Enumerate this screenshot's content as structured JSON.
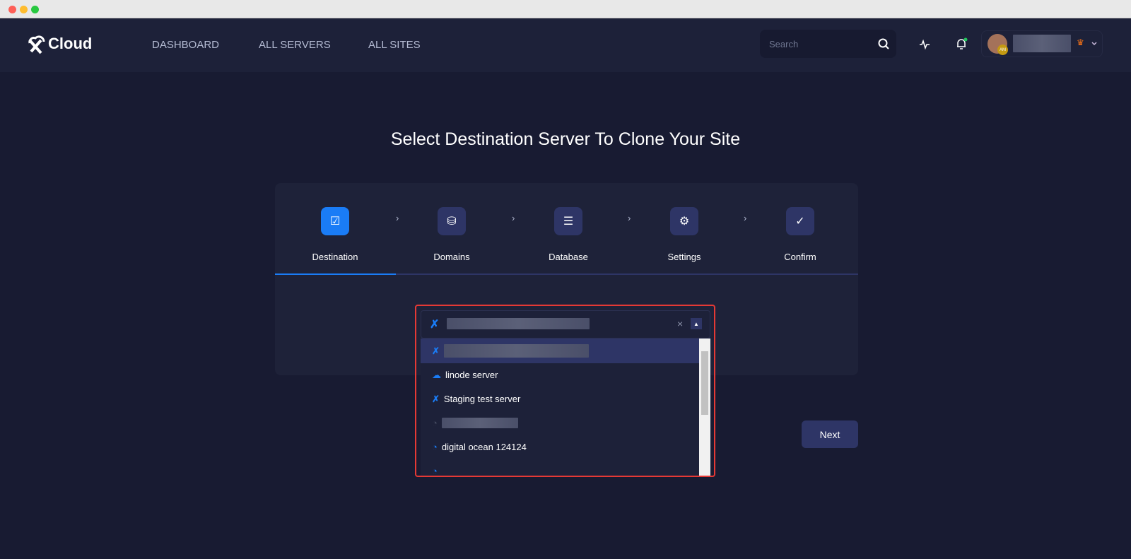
{
  "app": {
    "logo_text": "Cloud"
  },
  "nav": {
    "items": [
      {
        "label": "DASHBOARD"
      },
      {
        "label": "ALL SERVERS"
      },
      {
        "label": "ALL SITES"
      }
    ]
  },
  "search": {
    "placeholder": "Search"
  },
  "user": {
    "initials": "AM"
  },
  "page": {
    "title": "Select Destination Server To Clone Your Site"
  },
  "steps": [
    {
      "label": "Destination"
    },
    {
      "label": "Domains"
    },
    {
      "label": "Database"
    },
    {
      "label": "Settings"
    },
    {
      "label": "Confirm"
    }
  ],
  "dropdown": {
    "options": [
      {
        "label": "linode server",
        "provider": "linode"
      },
      {
        "label": "Staging test server",
        "provider": "xcloud"
      },
      {
        "label": "digital ocean 124124",
        "provider": "digitalocean"
      }
    ]
  },
  "buttons": {
    "next": "Next"
  },
  "colors": {
    "accent": "#1a7cf6",
    "highlight": "#2e3566",
    "outline": "#e53935"
  }
}
